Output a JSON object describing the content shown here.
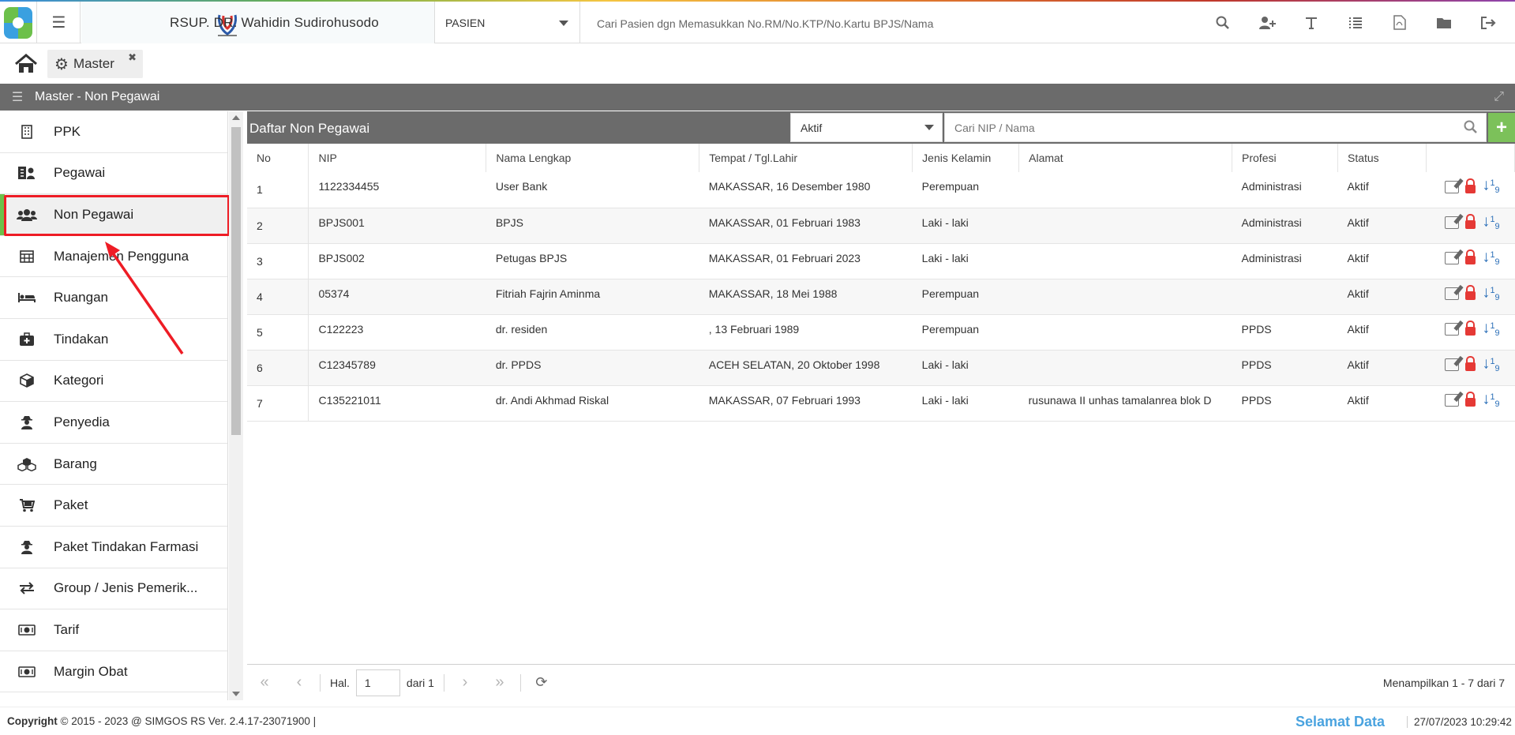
{
  "header": {
    "hospital_name": "RSUP. DR. Wahidin Sudirohusodo",
    "search_type": "PASIEN",
    "search_hint": "Cari Pasien dgn Memasukkan No.RM/No.KTP/No.Kartu BPJS/Nama",
    "icons": [
      "search-icon",
      "add-user-icon",
      "text-icon",
      "list-icon",
      "pdf-icon",
      "folder-icon",
      "logout-icon"
    ]
  },
  "tabs": {
    "home_icon": "home-icon",
    "active_tab": "Master"
  },
  "panel": {
    "title": "Master - Non Pegawai"
  },
  "sidebar": {
    "items": [
      {
        "label": "PPK",
        "icon": "building-icon"
      },
      {
        "label": "Pegawai",
        "icon": "employee-icon"
      },
      {
        "label": "Non Pegawai",
        "icon": "users-icon",
        "active": true
      },
      {
        "label": "Manajemen Pengguna",
        "icon": "table-icon"
      },
      {
        "label": "Ruangan",
        "icon": "bed-icon"
      },
      {
        "label": "Tindakan",
        "icon": "medkit-icon"
      },
      {
        "label": "Kategori",
        "icon": "cube-icon"
      },
      {
        "label": "Penyedia",
        "icon": "user-secret-icon"
      },
      {
        "label": "Barang",
        "icon": "cubes-icon"
      },
      {
        "label": "Paket",
        "icon": "cart-icon"
      },
      {
        "label": "Paket Tindakan Farmasi",
        "icon": "user-secret-icon"
      },
      {
        "label": "Group / Jenis Pemerik...",
        "icon": "exchange-icon"
      },
      {
        "label": "Tarif",
        "icon": "money-icon"
      },
      {
        "label": "Margin Obat",
        "icon": "money-icon"
      }
    ]
  },
  "list": {
    "title": "Daftar Non Pegawai",
    "status_filter": "Aktif",
    "search_placeholder": "Cari NIP / Nama",
    "add_label": "+",
    "columns": [
      "No",
      "NIP",
      "Nama Lengkap",
      "Tempat / Tgl.Lahir",
      "Jenis Kelamin",
      "Alamat",
      "Profesi",
      "Status",
      ""
    ],
    "rows": [
      {
        "no": "1",
        "nip": "1122334455",
        "nama": "User Bank",
        "ttl": "MAKASSAR, 16 Desember 1980",
        "jk": "Perempuan",
        "alamat": "",
        "profesi": "Administrasi",
        "status": "Aktif"
      },
      {
        "no": "2",
        "nip": "BPJS001",
        "nama": "BPJS",
        "ttl": "MAKASSAR, 01 Februari 1983",
        "jk": "Laki - laki",
        "alamat": "",
        "profesi": "Administrasi",
        "status": "Aktif"
      },
      {
        "no": "3",
        "nip": "BPJS002",
        "nama": "Petugas BPJS",
        "ttl": "MAKASSAR, 01 Februari 2023",
        "jk": "Laki - laki",
        "alamat": "",
        "profesi": "Administrasi",
        "status": "Aktif"
      },
      {
        "no": "4",
        "nip": "05374",
        "nama": "Fitriah Fajrin Aminma",
        "ttl": "MAKASSAR, 18 Mei 1988",
        "jk": "Perempuan",
        "alamat": "",
        "profesi": "",
        "status": "Aktif"
      },
      {
        "no": "5",
        "nip": "C122223",
        "nama": "dr. residen",
        "ttl": ", 13 Februari 1989",
        "jk": "Perempuan",
        "alamat": "",
        "profesi": "PPDS",
        "status": "Aktif"
      },
      {
        "no": "6",
        "nip": "C12345789",
        "nama": "dr. PPDS",
        "ttl": "ACEH SELATAN, 20 Oktober 1998",
        "jk": "Laki - laki",
        "alamat": "",
        "profesi": "PPDS",
        "status": "Aktif"
      },
      {
        "no": "7",
        "nip": "C135221011",
        "nama": "dr. Andi Akhmad Riskal",
        "ttl": "MAKASSAR, 07 Februari 1993",
        "jk": "Laki - laki",
        "alamat": "rusunawa II unhas tamalanrea blok D",
        "profesi": "PPDS",
        "status": "Aktif"
      }
    ]
  },
  "pager": {
    "page_label": "Hal.",
    "page_value": "1",
    "of_label": "dari 1",
    "info": "Menampilkan 1 - 7 dari 7"
  },
  "footer": {
    "copyright_label": "Copyright",
    "copyright_text": "2015 - 2023 @ SIMGOS RS Ver. 2.4.17-23071900",
    "welcome": "Selamat Data",
    "datetime": "27/07/2023 10:29:42"
  },
  "colors": {
    "accent_green": "#7cc15a",
    "panel_gray": "#6b6b6b",
    "highlight_red": "#ee1c25",
    "welcome_blue": "#4aa3df"
  }
}
